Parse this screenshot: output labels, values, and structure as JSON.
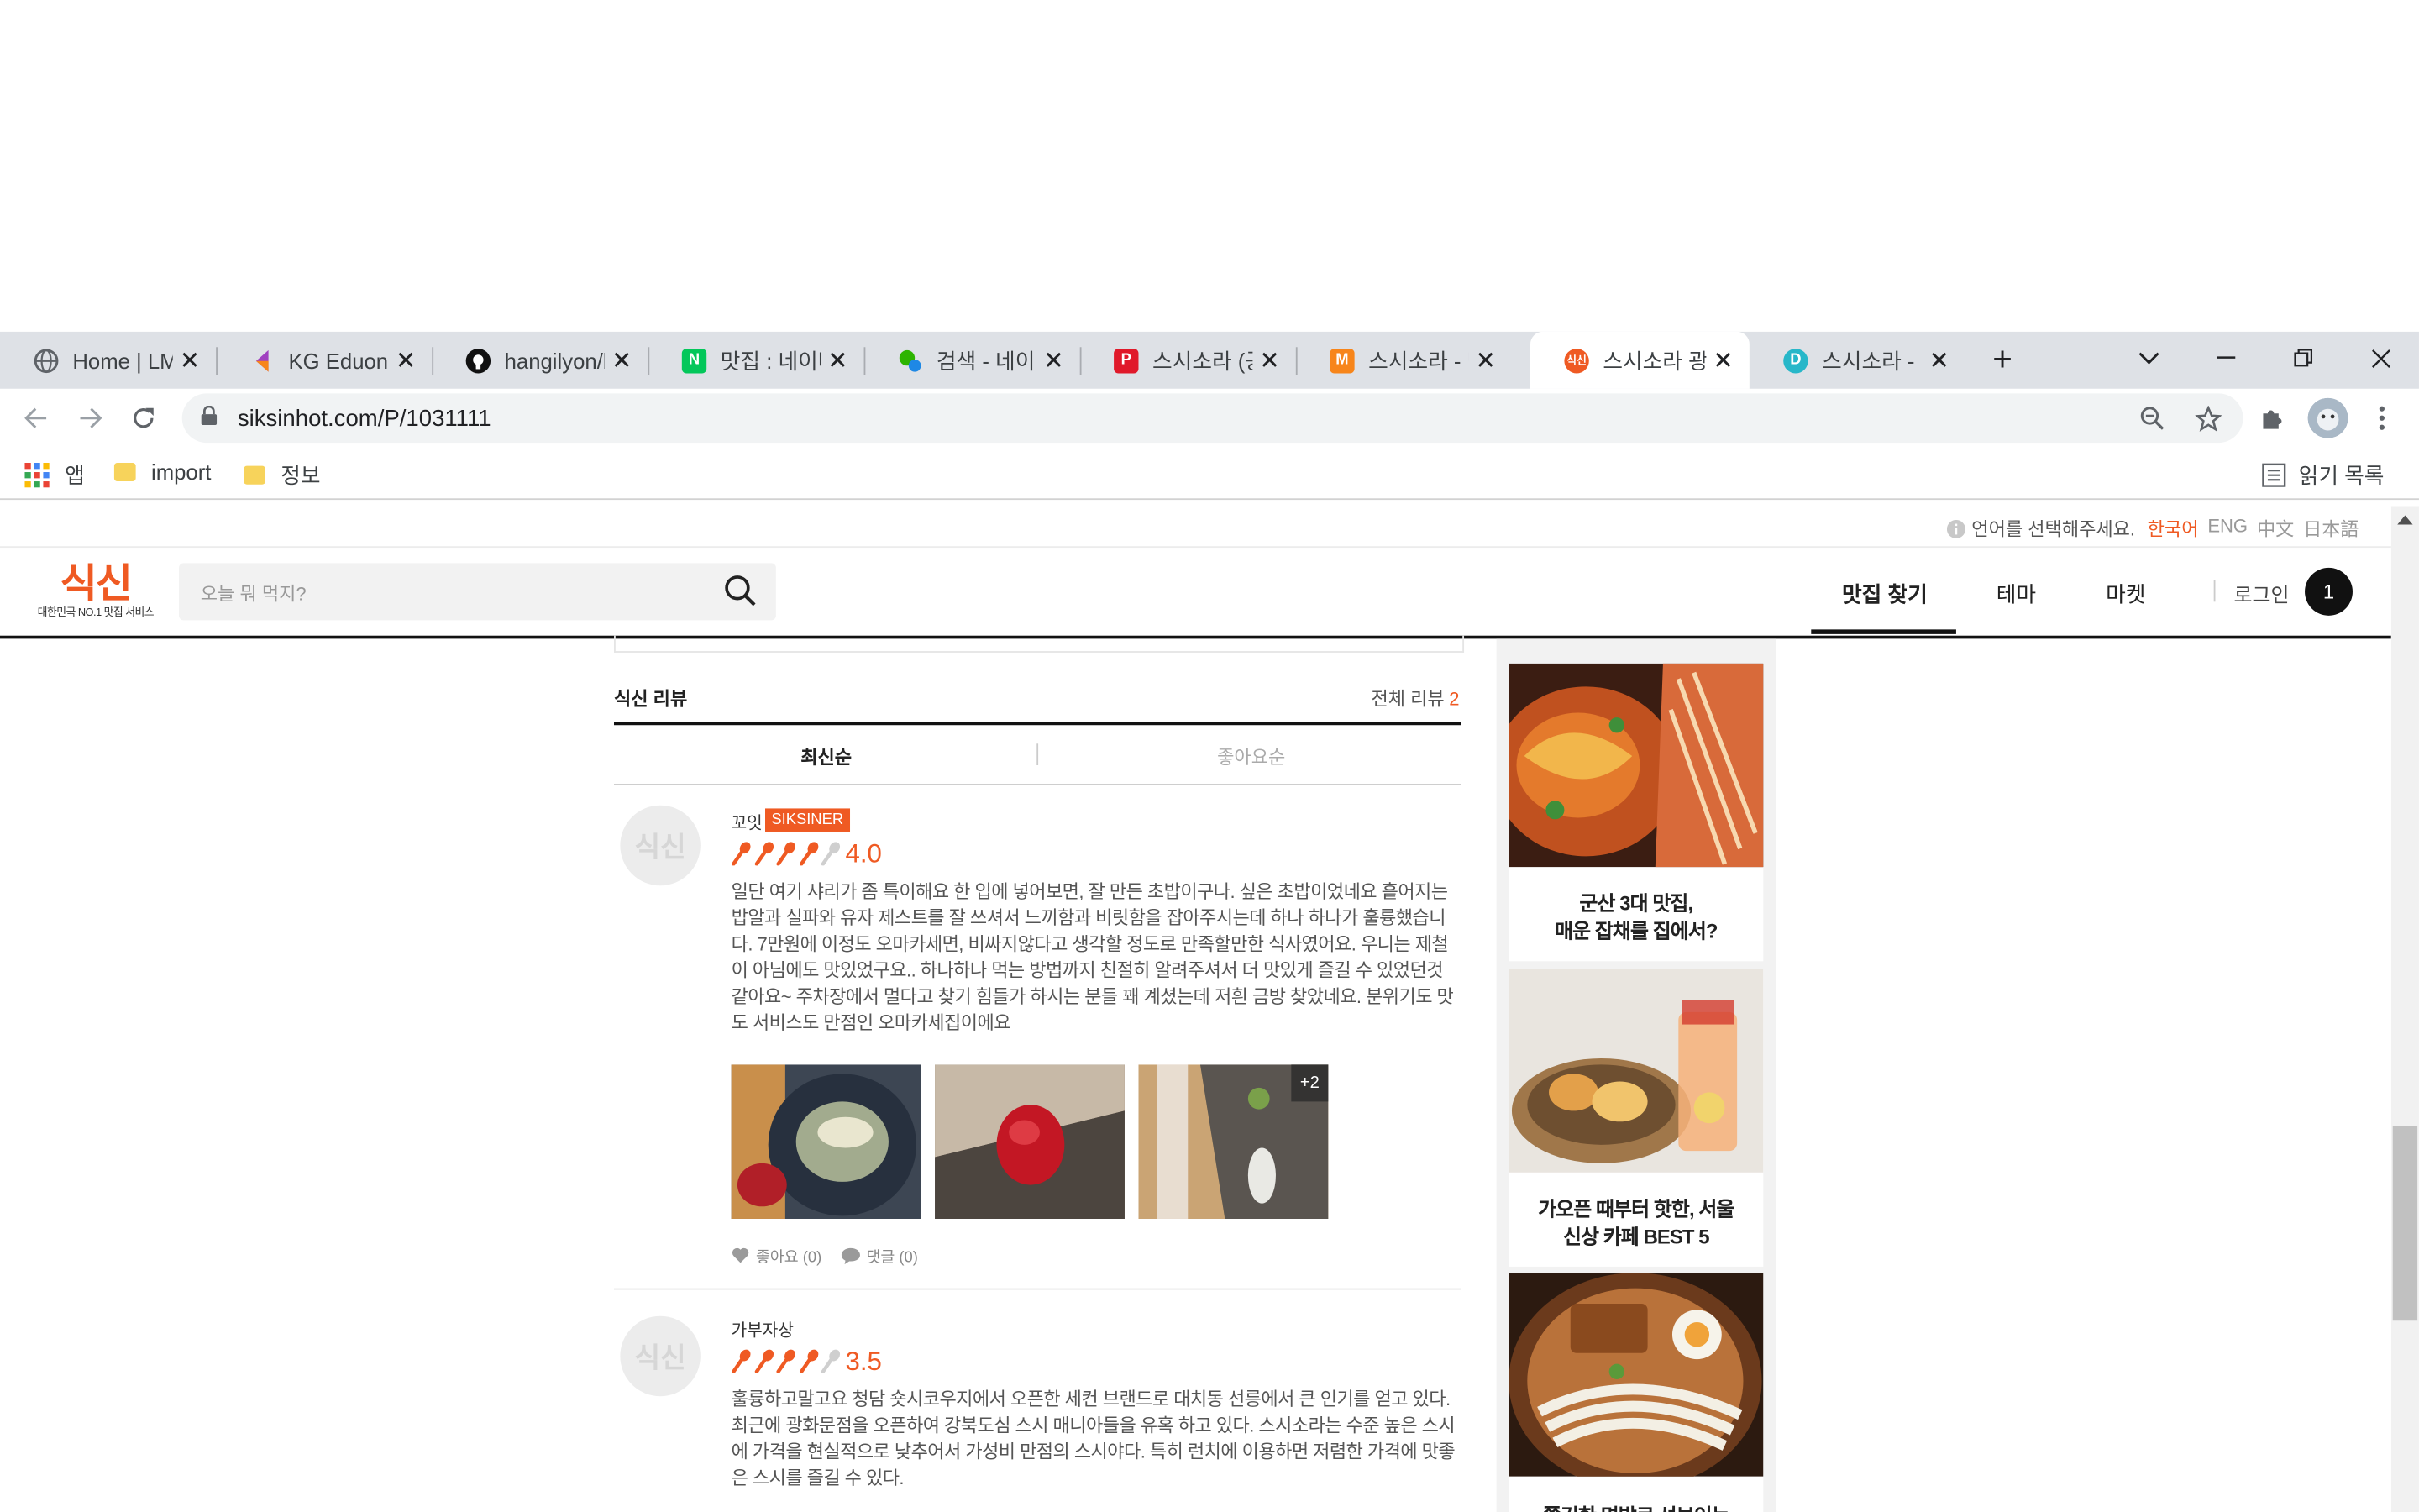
{
  "tabs": [
    {
      "title": "Home | LMS",
      "favicon": "globe-icon",
      "color": "#5f6368"
    },
    {
      "title": "KG Eduone",
      "favicon": "kg-icon",
      "color": "#a040c0"
    },
    {
      "title": "hangilyon/b",
      "favicon": "github-icon",
      "color": "#111111"
    },
    {
      "title": "맛집 : 네이버",
      "favicon": "naver-icon",
      "color": "#03c75a"
    },
    {
      "title": "검색 - 네이버",
      "favicon": "map-icon",
      "color": "#2db400"
    },
    {
      "title": "스시소라 (공",
      "favicon": "p-icon",
      "color": "#e0192a"
    },
    {
      "title": "스시소라 - 망",
      "favicon": "m-icon",
      "color": "#f7851a"
    },
    {
      "title": "스시소라 광",
      "favicon": "siksin-icon",
      "color": "#ef5a23"
    },
    {
      "title": "스시소라 - 디",
      "favicon": "d-icon",
      "color": "#27b7c9"
    }
  ],
  "browser": {
    "url": "siksinhot.com/P/1031111",
    "bookmarks": {
      "apps": "앱",
      "b1": "import",
      "b2": "정보",
      "reading_list": "읽기 목록"
    }
  },
  "langbar": {
    "prompt": "언어를 선택해주세요.",
    "ko": "한국어",
    "en": "ENG",
    "zh": "中文",
    "ja": "日本語",
    "active_color": "#ef5a23"
  },
  "header": {
    "logo_main": "식신",
    "logo_sub": "대한민국 NO.1 맛집 서비스",
    "search_placeholder": "오늘 뭐 먹지?",
    "nav": {
      "find": "맛집 찾기",
      "theme": "테마",
      "market": "마켓",
      "login": "로그인"
    },
    "cart_count": "1"
  },
  "reviews_section": {
    "title": "식신 리뷰",
    "total_label": "전체 리뷰",
    "total_count": "2",
    "sort_latest": "최신순",
    "sort_likes": "좋아요순"
  },
  "reviews": [
    {
      "avatar": "식신",
      "user": "꼬잇",
      "badge": "SIKSINER",
      "rating": "4.0",
      "rating_value": 4.0,
      "text": "일단 여기 샤리가 좀 특이해요 한 입에 넣어보면, 잘 만든 초밥이구나. 싶은 초밥이었네요 흩어지는 밥알과 실파와 유자 제스트를 잘 쓰셔서 느끼함과 비릿함을 잡아주시는데 하나 하나가 훌륭했습니다. 7만원에 이정도 오마카세면, 비싸지않다고 생각할 정도로 만족할만한 식사였어요. 우니는 제철이 아님에도 맛있었구요.. 하나하나 먹는 방법까지 친절히 알려주셔서 더 맛있게 즐길 수 있었던것 같아요~ 주차장에서 멀다고 찾기 힘들가 하시는 분들 꽤 계셨는데 저흰 금방 찾았네요. 분위기도 맛도 서비스도 만점인 오마카세집이에요",
      "photo_more": "+2",
      "like_label": "좋아요 (0)",
      "comment_label": "댓글 (0)"
    },
    {
      "avatar": "식신",
      "user": "가부자상",
      "rating": "3.5",
      "rating_value": 3.5,
      "text": "훌륭하고말고요 청담 숏시코우지에서 오픈한 세컨 브랜드로 대치동 선릉에서 큰 인기를 얻고 있다. 최근에 광화문점을 오픈하여 강북도심 스시 매니아들을 유혹 하고 있다. 스시소라는 수준 높은 스시에 가격을 현실적으로 낮추어서 가성비 만점의 스시야다. 특히 런치에 이용하면 저렴한 가격에 맛좋은 스시를 즐길 수 있다."
    }
  ],
  "rail": [
    {
      "caption_line1": "군산 3대 맛집,",
      "caption_line2": "매운 잡채를 집에서?"
    },
    {
      "caption_line1": "가오픈 때부터 핫한, 서울",
      "caption_line2": "신상 카페 BEST 5"
    },
    {
      "caption_line1": "쫄깃한 면발로 선보이는",
      "caption_line2": ""
    }
  ],
  "colors": {
    "accent": "#ef5a23",
    "tabbar": "#dee1e6"
  }
}
